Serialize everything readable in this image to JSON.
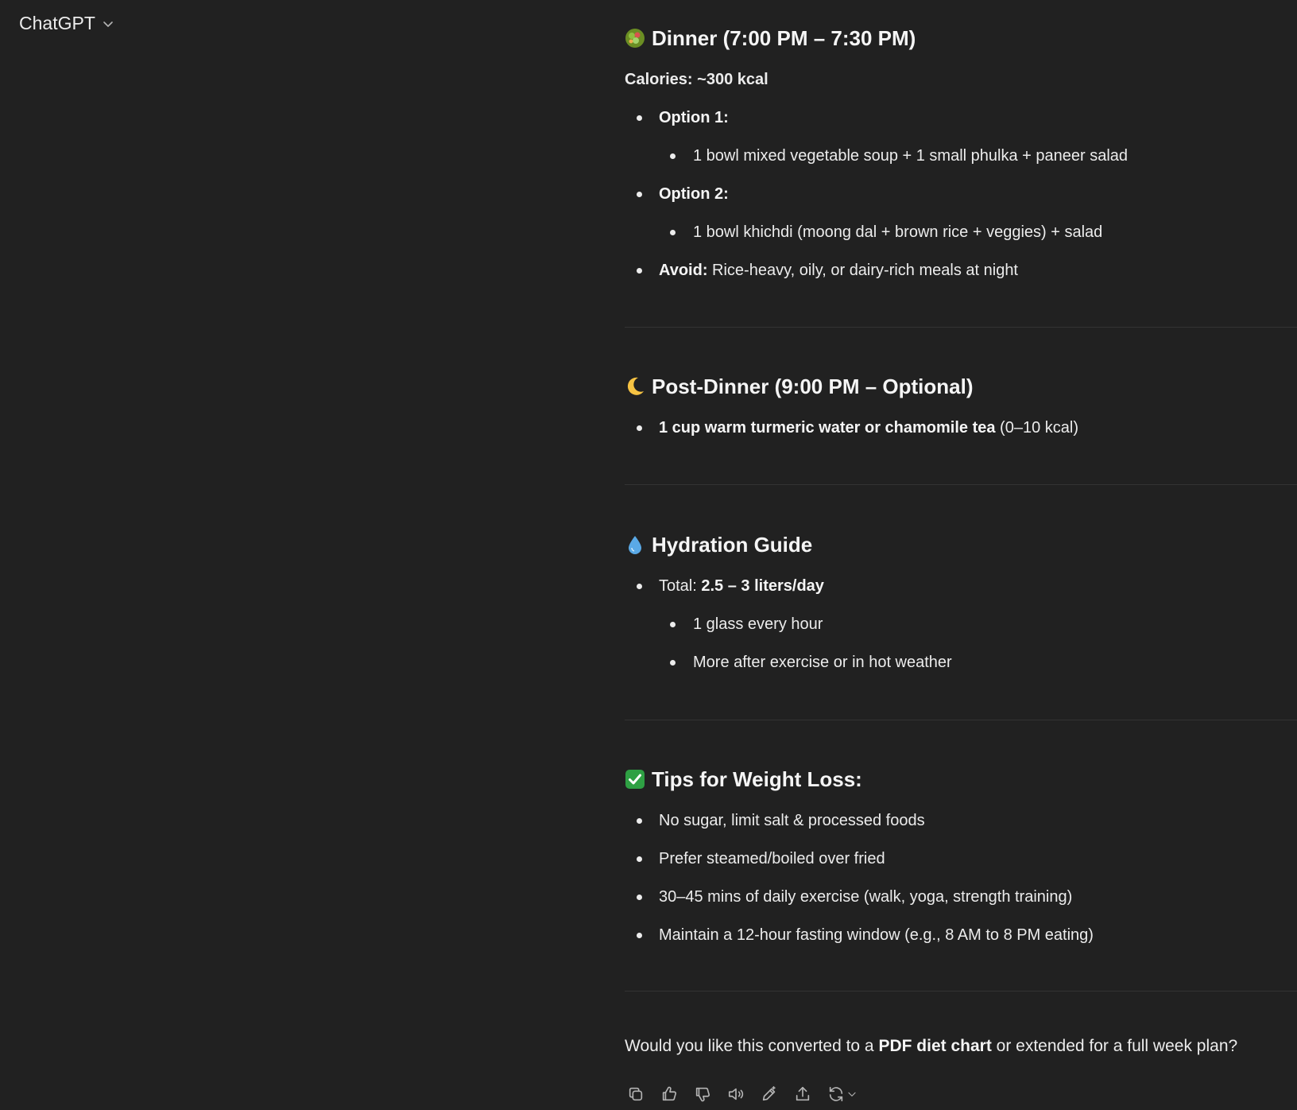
{
  "header": {
    "title": "ChatGPT"
  },
  "dinner": {
    "title": "Dinner (7:00 PM – 7:30 PM)",
    "calories": "Calories: ~300 kcal",
    "option1_label": "Option 1:",
    "option1_item": "1 bowl mixed vegetable soup + 1 small phulka + paneer salad",
    "option2_label": "Option 2:",
    "option2_item": "1 bowl khichdi (moong dal + brown rice + veggies) + salad",
    "avoid_label": "Avoid:",
    "avoid_text": " Rice-heavy, oily, or dairy-rich meals at night"
  },
  "post_dinner": {
    "title": "Post-Dinner (9:00 PM – Optional)",
    "item_bold": "1 cup warm turmeric water or chamomile tea",
    "item_rest": " (0–10 kcal)"
  },
  "hydration": {
    "title": "Hydration Guide",
    "total_label": "Total: ",
    "total_value": "2.5 – 3 liters/day",
    "sub_items": [
      "1 glass every hour",
      "More after exercise or in hot weather"
    ]
  },
  "tips": {
    "title": "Tips for Weight Loss:",
    "items": [
      "No sugar, limit salt & processed foods",
      "Prefer steamed/boiled over fried",
      "30–45 mins of daily exercise (walk, yoga, strength training)",
      "Maintain a 12-hour fasting window (e.g., 8 AM to 8 PM eating)"
    ]
  },
  "closing": {
    "before": "Would you like this converted to a ",
    "bold": "PDF diet chart",
    "after": " or extended for a full week plan?"
  },
  "icons": {
    "header_chevron": "chevron-down-icon",
    "dinner": "salad-icon",
    "post_dinner": "crescent-moon-icon",
    "hydration": "droplet-icon",
    "tips": "check-mark-button-icon",
    "actions": [
      "copy-icon",
      "thumbs-up-icon",
      "thumbs-down-icon",
      "read-aloud-icon",
      "edit-icon",
      "share-icon",
      "regenerate-icon",
      "chevron-down-icon"
    ]
  },
  "colors": {
    "background": "#212121",
    "text": "#ececec",
    "divider": "#333333",
    "check_green": "#2ea043"
  }
}
